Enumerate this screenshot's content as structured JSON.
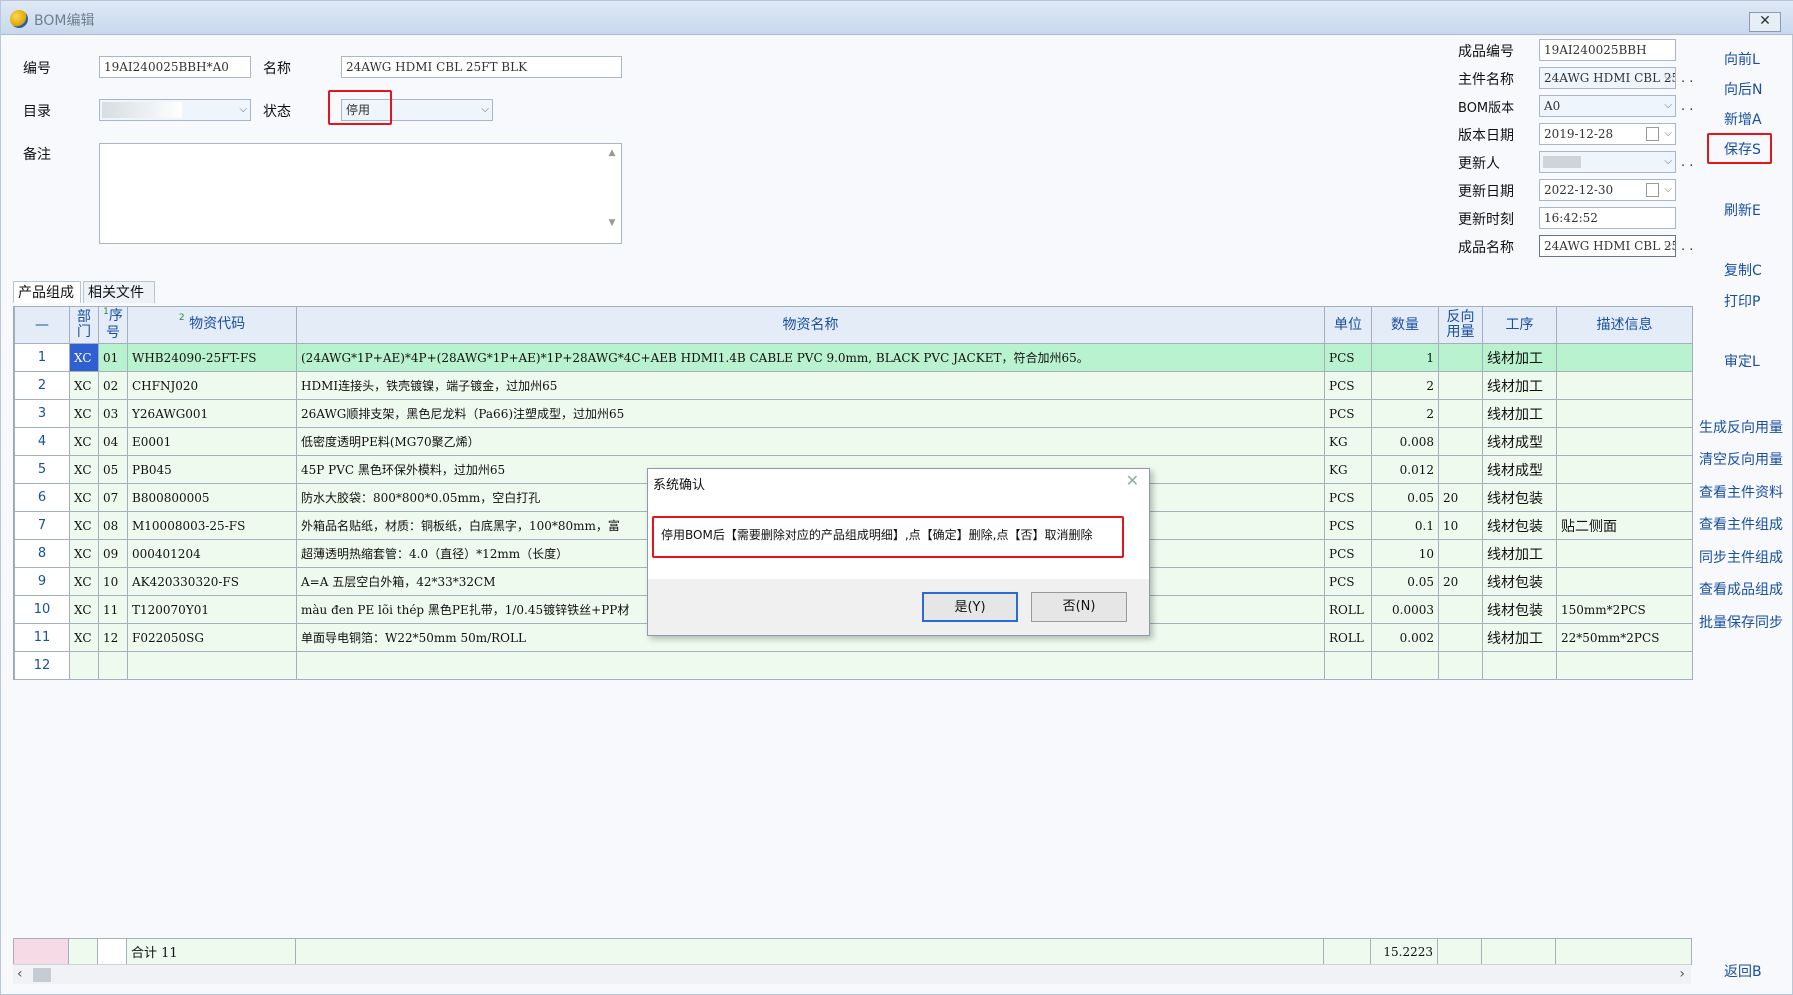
{
  "window": {
    "title": "BOM编辑",
    "close_label": "✕"
  },
  "form": {
    "code_label": "编号",
    "code_value": "19AI240025BBH*A0",
    "name_label": "名称",
    "name_value": "24AWG HDMI CBL 25FT BLK",
    "dir_label": "目录",
    "status_label": "状态",
    "status_value": "停用",
    "note_label": "备注"
  },
  "right_form": {
    "product_code_label": "成品编号",
    "product_code_value": "19AI240025BBH",
    "main_name_label": "主件名称",
    "main_name_value": "24AWG HDMI CBL 25",
    "bom_version_label": "BOM版本",
    "bom_version_value": "A0",
    "version_date_label": "版本日期",
    "version_date_value": "2019-12-28",
    "updater_label": "更新人",
    "update_date_label": "更新日期",
    "update_date_value": "2022-12-30",
    "update_time_label": "更新时刻",
    "update_time_value": "16:42:52",
    "product_name_label": "成品名称",
    "product_name_value": "24AWG HDMI CBL 25",
    "dots": ". ."
  },
  "side_buttons": {
    "prev": "向前L",
    "next": "向后N",
    "add": "新增A",
    "save": "保存S",
    "refresh": "刷新E",
    "copy": "复制C",
    "print": "打印P",
    "audit": "审定L",
    "gen_reverse": "生成反向用量",
    "clear_reverse": "清空反向用量",
    "view_main_info": "查看主件资料",
    "view_main_comp": "查看主件组成",
    "sync_main_comp": "同步主件组成",
    "view_product_comp": "查看成品组成",
    "batch_save_sync": "批量保存同步",
    "back": "返回B"
  },
  "tabs": {
    "composition": "产品组成",
    "files": "相关文件"
  },
  "table": {
    "headers": {
      "corner": "—",
      "dept": "部\n门",
      "seq": "序\n号",
      "seq_sort": "1",
      "code_sort": "2",
      "code": "物资代码",
      "name": "物资名称",
      "unit": "单位",
      "qty": "数量",
      "reverse": "反向\n用量",
      "process": "工序",
      "desc": "描述信息"
    },
    "rows": [
      {
        "rn": "1",
        "dept": "XC",
        "seq": "01",
        "code": "WHB24090-25FT-FS",
        "name": "(24AWG*1P+AE)*4P+(28AWG*1P+AE)*1P+28AWG*4C+AEB HDMI1.4B CABLE PVC 9.0mm, BLACK PVC JACKET，符合加州65。",
        "unit": "PCS",
        "qty": "1",
        "rev": "",
        "proc": "线材加工",
        "desc": ""
      },
      {
        "rn": "2",
        "dept": "XC",
        "seq": "02",
        "code": "CHFNJ020",
        "name": "HDMI连接头，铁壳镀镍，端子镀金，过加州65",
        "unit": "PCS",
        "qty": "2",
        "rev": "",
        "proc": "线材加工",
        "desc": ""
      },
      {
        "rn": "3",
        "dept": "XC",
        "seq": "03",
        "code": "Y26AWG001",
        "name": "26AWG顺排支架，黑色尼龙料（Pa66)注塑成型，过加州65",
        "unit": "PCS",
        "qty": "2",
        "rev": "",
        "proc": "线材加工",
        "desc": ""
      },
      {
        "rn": "4",
        "dept": "XC",
        "seq": "04",
        "code": "E0001",
        "name": "低密度透明PE料(MG70聚乙烯）",
        "unit": "KG",
        "qty": "0.008",
        "rev": "",
        "proc": "线材成型",
        "desc": ""
      },
      {
        "rn": "5",
        "dept": "XC",
        "seq": "05",
        "code": "PB045",
        "name": "45P PVC 黑色环保外模料，过加州65",
        "unit": "KG",
        "qty": "0.012",
        "rev": "",
        "proc": "线材成型",
        "desc": ""
      },
      {
        "rn": "6",
        "dept": "XC",
        "seq": "07",
        "code": "B800800005",
        "name": "防水大胶袋：800*800*0.05mm，空白打孔",
        "unit": "PCS",
        "qty": "0.05",
        "rev": "20",
        "proc": "线材包装",
        "desc": ""
      },
      {
        "rn": "7",
        "dept": "XC",
        "seq": "08",
        "code": "M10008003-25-FS",
        "name": "外箱品名贴纸，材质：铜板纸，白底黑字，100*80mm，富",
        "unit": "PCS",
        "qty": "0.1",
        "rev": "10",
        "proc": "线材包装",
        "desc": "贴二侧面"
      },
      {
        "rn": "8",
        "dept": "XC",
        "seq": "09",
        "code": "000401204",
        "name": "超薄透明热缩套管：4.0（直径）*12mm（长度）",
        "unit": "PCS",
        "qty": "10",
        "rev": "",
        "proc": "线材加工",
        "desc": ""
      },
      {
        "rn": "9",
        "dept": "XC",
        "seq": "10",
        "code": "AK420330320-FS",
        "name": "A=A  五层空白外箱，42*33*32CM",
        "unit": "PCS",
        "qty": "0.05",
        "rev": "20",
        "proc": "线材包装",
        "desc": ""
      },
      {
        "rn": "10",
        "dept": "XC",
        "seq": "11",
        "code": "T120070Y01",
        "name": "màu đen PE lõi thép 黑色PE扎带，1/0.45镀锌铁丝+PP材",
        "unit": "ROLL",
        "qty": "0.0003",
        "rev": "",
        "proc": "线材包装",
        "desc": "150mm*2PCS"
      },
      {
        "rn": "11",
        "dept": "XC",
        "seq": "12",
        "code": "F022050SG",
        "name": "单面导电铜箔：W22*50mm 50m/ROLL",
        "unit": "ROLL",
        "qty": "0.002",
        "rev": "",
        "proc": "线材加工",
        "desc": "22*50mm*2PCS"
      },
      {
        "rn": "12",
        "dept": "",
        "seq": "",
        "code": "",
        "name": "",
        "unit": "",
        "qty": "",
        "rev": "",
        "proc": "",
        "desc": ""
      }
    ],
    "total_label": "合计 11",
    "total_qty": "15.2223"
  },
  "dialog": {
    "title": "系统确认",
    "close": "✕",
    "message": "停用BOM后【需要删除对应的产品组成明细】,点【确定】删除,点【否】取消删除",
    "yes": "是(Y)",
    "no": "否(N)"
  },
  "colors": {
    "accent_red": "#e2161b",
    "link_blue": "#1a4fa3",
    "selected_row": "#b8f2cf",
    "row_bg": "#eefaee"
  }
}
